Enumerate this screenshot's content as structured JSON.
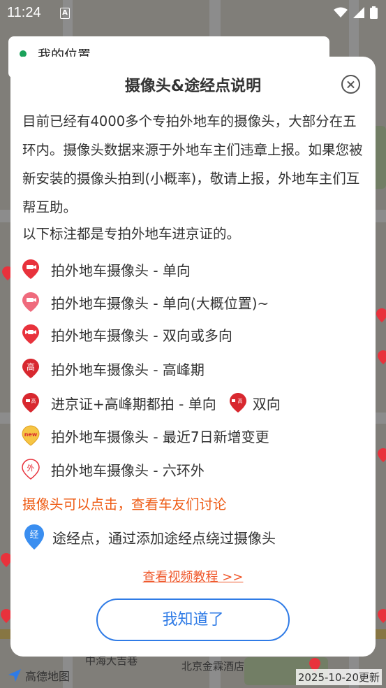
{
  "status_bar": {
    "time": "11:24",
    "sim_label": "A"
  },
  "map": {
    "location_label": "我的位置",
    "logo_text": "高德地图",
    "label_mall": "中海大吉巷",
    "label_hotel": "北京金霖酒店",
    "update_text": "2025-10-20更新"
  },
  "dialog": {
    "title": "摄像头&途经点说明",
    "description": "目前已经有4000多个专拍外地车的摄像头，大部分在五环内。摄像头数据来源于外地车主们违章上报。如果您被新安装的摄像头拍到(小概率)，敬请上报，外地车主们互帮互助。",
    "description2": "以下标注都是专拍外地车进京证的。",
    "legend": [
      {
        "icon": "camera-red-pin-icon",
        "label": "拍外地车摄像头 - 单向"
      },
      {
        "icon": "camera-pink-pin-icon",
        "label": "拍外地车摄像头 - 单向(大概位置)~"
      },
      {
        "icon": "camera-bidirectional-pin-icon",
        "label": "拍外地车摄像头 - 双向或多向"
      },
      {
        "icon": "peak-hour-pin-icon",
        "label": "拍外地车摄像头 - 高峰期"
      },
      {
        "icon": "permit-peak-pin-icon",
        "label": "进京证+高峰期都拍 - 单向",
        "icon2": "permit-peak-bidirectional-pin-icon",
        "label2": "双向"
      },
      {
        "icon": "new-pin-icon",
        "label": "拍外地车摄像头 - 最近7日新增变更"
      },
      {
        "icon": "outside-sixth-ring-pin-icon",
        "label": "拍外地车摄像头 - 六环外"
      }
    ],
    "note": "摄像头可以点击，查看车友们讨论",
    "waypoint_icon_text": "经",
    "waypoint_text": "途经点，通过添加途经点绕过摄像头",
    "tutorial_link": "查看视频教程 >>",
    "ok_button": "我知道了",
    "pin_glyph_peak": "高",
    "pin_glyph_new": "new",
    "pin_glyph_outside": "外"
  },
  "colors": {
    "accent_blue": "#2f7be6",
    "note_orange": "#ee5b14",
    "pin_red": "#e8323c",
    "pin_pink": "#ef6b7d",
    "pin_yellow": "#f6c544"
  }
}
